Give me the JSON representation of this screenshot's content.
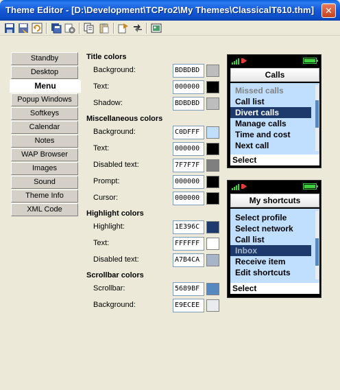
{
  "window": {
    "title": "Theme Editor - [D:\\Development\\TCPro2\\My Themes\\ClassicalT610.thm]",
    "close_glyph": "✕"
  },
  "toolbar": {
    "buttons": [
      {
        "name": "save-icon",
        "color": "#2A4E9A"
      },
      {
        "name": "save-as-icon",
        "color": "#5A6FA8"
      },
      {
        "name": "refresh-icon",
        "color": "#D18A1E"
      },
      {
        "name": "save-all-icon",
        "color": "#2A4E9A"
      },
      {
        "name": "settings-icon",
        "color": "#7A7A7A"
      },
      {
        "name": "copy-icon",
        "color": "#6B6B6B"
      },
      {
        "name": "paste-icon",
        "color": "#9A9A9A"
      },
      {
        "name": "export-icon",
        "color": "#C98A2A"
      },
      {
        "name": "swap-icon",
        "color": "#3A3A3A"
      },
      {
        "name": "preview-icon",
        "color": "#2F8A4A"
      }
    ]
  },
  "sidebar": {
    "items": [
      {
        "label": "Standby",
        "active": false
      },
      {
        "label": "Desktop",
        "active": false
      },
      {
        "label": "Menu",
        "active": true
      },
      {
        "label": "Popup Windows",
        "active": false
      },
      {
        "label": "Softkeys",
        "active": false
      },
      {
        "label": "Calendar",
        "active": false
      },
      {
        "label": "Notes",
        "active": false
      },
      {
        "label": "WAP Browser",
        "active": false
      },
      {
        "label": "Images",
        "active": false
      },
      {
        "label": "Sound",
        "active": false
      },
      {
        "label": "Theme Info",
        "active": false
      },
      {
        "label": "XML Code",
        "active": false
      }
    ]
  },
  "colors": {
    "title": {
      "heading": "Title colors",
      "rows": [
        {
          "label": "Background:",
          "hex": "BDBDBD",
          "color": "#BDBDBD"
        },
        {
          "label": "Text:",
          "hex": "000000",
          "color": "#000000"
        },
        {
          "label": "Shadow:",
          "hex": "BDBDBD",
          "color": "#BDBDBD"
        }
      ]
    },
    "misc": {
      "heading": "Miscellaneous colors",
      "rows": [
        {
          "label": "Background:",
          "hex": "C0DFFF",
          "color": "#C0DFFF"
        },
        {
          "label": "Text:",
          "hex": "000000",
          "color": "#000000"
        },
        {
          "label": "Disabled text:",
          "hex": "7F7F7F",
          "color": "#7F7F7F"
        },
        {
          "label": "Prompt:",
          "hex": "000000",
          "color": "#000000"
        },
        {
          "label": "Cursor:",
          "hex": "000000",
          "color": "#000000"
        }
      ]
    },
    "highlight": {
      "heading": "Highlight colors",
      "rows": [
        {
          "label": "Highlight:",
          "hex": "1E396C",
          "color": "#1E396C"
        },
        {
          "label": "Text:",
          "hex": "FFFFFF",
          "color": "#FFFFFF"
        },
        {
          "label": "Disabled text:",
          "hex": "A7B4CA",
          "color": "#A7B4CA"
        }
      ]
    },
    "scrollbar": {
      "heading": "Scrollbar colors",
      "rows": [
        {
          "label": "Scrollbar:",
          "hex": "5689BF",
          "color": "#5689BF"
        },
        {
          "label": "Background:",
          "hex": "E9ECEE",
          "color": "#E9ECEE"
        }
      ]
    }
  },
  "previews": [
    {
      "title": "Calls",
      "items": [
        {
          "label": "Missed calls",
          "disabled": true,
          "highlighted": false
        },
        {
          "label": "Call list",
          "disabled": false,
          "highlighted": false
        },
        {
          "label": "Divert calls",
          "disabled": false,
          "highlighted": true
        },
        {
          "label": "Manage calls",
          "disabled": false,
          "highlighted": false
        },
        {
          "label": "Time and cost",
          "disabled": false,
          "highlighted": false
        },
        {
          "label": "Next call",
          "disabled": false,
          "highlighted": false
        }
      ],
      "softkey": "Select"
    },
    {
      "title": "My shortcuts",
      "items": [
        {
          "label": "Select profile",
          "disabled": false,
          "highlighted": false
        },
        {
          "label": "Select network",
          "disabled": false,
          "highlighted": false
        },
        {
          "label": "Call list",
          "disabled": false,
          "highlighted": false
        },
        {
          "label": "Inbox",
          "disabled": true,
          "highlighted": true
        },
        {
          "label": "Receive item",
          "disabled": false,
          "highlighted": false
        },
        {
          "label": "Edit shortcuts",
          "disabled": false,
          "highlighted": false
        }
      ],
      "softkey": "Select"
    }
  ]
}
